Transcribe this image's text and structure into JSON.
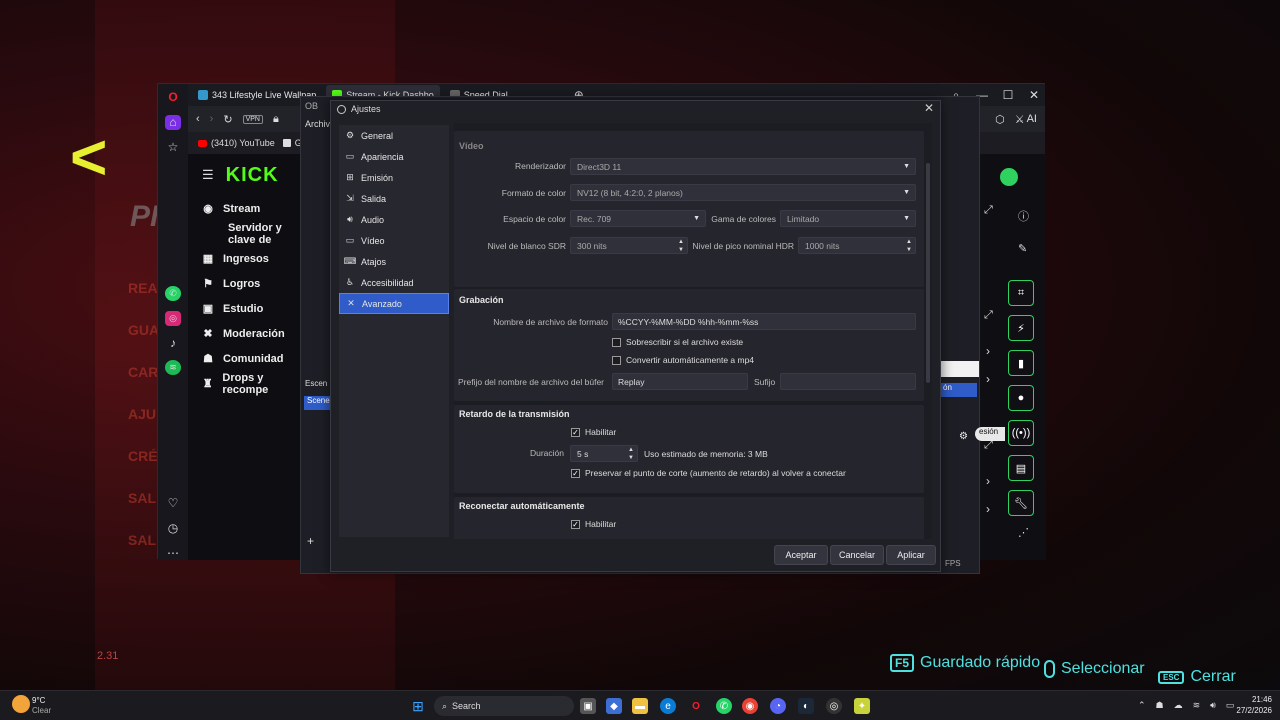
{
  "background": {
    "left_words": [
      "REA",
      "GUA",
      "CAR",
      "AJU",
      "CRÉ",
      "SAL",
      "SAL"
    ],
    "big_text": "PI",
    "corner_number": "2.31",
    "hud": [
      {
        "key": "F5",
        "label": "Guardado rápido"
      },
      {
        "key": "",
        "label": "Seleccionar"
      },
      {
        "key": "ESC",
        "label": "Cerrar"
      }
    ]
  },
  "browser": {
    "tabs": [
      {
        "label": "343 Lifestyle Live Wallpap"
      },
      {
        "label": "Stream - Kick Dashbo"
      },
      {
        "label": "Speed Dial"
      }
    ],
    "vpn_badge": "VPN",
    "bookmarks": [
      {
        "label": "(3410) YouTube"
      },
      {
        "label": "Goog"
      }
    ],
    "right_label": "AI",
    "kick": {
      "logo": "KICK",
      "menu": [
        {
          "icon": "stream-icon",
          "label": "Stream"
        },
        {
          "icon": "",
          "label": "Servidor y clave de"
        },
        {
          "icon": "ingresos-icon",
          "label": "Ingresos"
        },
        {
          "icon": "logros-icon",
          "label": "Logros"
        },
        {
          "icon": "estudio-icon",
          "label": "Estudio"
        },
        {
          "icon": "moderacion-icon",
          "label": "Moderación"
        },
        {
          "icon": "comunidad-icon",
          "label": "Comunidad"
        },
        {
          "icon": "drops-icon",
          "label": "Drops y recompe"
        }
      ],
      "right_badge": "esión",
      "right_badge2": "ón"
    }
  },
  "obs": {
    "menu_label": "Archiv",
    "scenes_label": "Escen",
    "scene_item": "Scene",
    "fps": "FPS",
    "ob_label": "OB"
  },
  "dialog": {
    "title": "Ajustes",
    "categories": [
      {
        "icon": "gear-icon",
        "label": "General"
      },
      {
        "icon": "monitor-icon",
        "label": "Apariencia"
      },
      {
        "icon": "broadcast-icon",
        "label": "Emisión"
      },
      {
        "icon": "output-icon",
        "label": "Salida"
      },
      {
        "icon": "speaker-icon",
        "label": "Audio"
      },
      {
        "icon": "video-icon",
        "label": "Vídeo"
      },
      {
        "icon": "keyboard-icon",
        "label": "Atajos"
      },
      {
        "icon": "accessibility-icon",
        "label": "Accesibilidad"
      },
      {
        "icon": "wrench-icon",
        "label": "Avanzado"
      }
    ],
    "selected_category": "Avanzado",
    "video": {
      "title": "Vídeo",
      "renderer_label": "Renderizador",
      "renderer_value": "Direct3D 11",
      "color_format_label": "Formato de color",
      "color_format_value": "NV12 (8 bit, 4:2:0, 2 planos)",
      "color_space_label": "Espacio de color",
      "color_space_value": "Rec. 709",
      "color_range_label": "Gama de colores",
      "color_range_value": "Limitado",
      "sdr_label": "Nivel de blanco SDR",
      "sdr_value": "300 nits",
      "hdr_label": "Nivel de pico nominal HDR",
      "hdr_value": "1000 nits"
    },
    "recording": {
      "title": "Grabación",
      "filename_label": "Nombre de archivo de formato",
      "filename_value": "%CCYY-%MM-%DD %hh-%mm-%ss",
      "overwrite_label": "Sobrescribir si el archivo existe",
      "overwrite_checked": false,
      "remux_label": "Convertir automáticamente a mp4",
      "remux_checked": false,
      "replay_prefix_label": "Prefijo del nombre de archivo del búfer",
      "replay_prefix_value": "Replay",
      "suffix_label": "Sufijo",
      "suffix_value": ""
    },
    "stream_delay": {
      "title": "Retardo de la transmisión",
      "enable_label": "Habilitar",
      "enable_checked": true,
      "duration_label": "Duración",
      "duration_value": "5 s",
      "memory_text": "Uso estimado de memoria: 3 MB",
      "preserve_label": "Preservar el punto de corte (aumento de retardo) al volver a conectar",
      "preserve_checked": true
    },
    "reconnect": {
      "title": "Reconectar automáticamente",
      "enable_label": "Habilitar",
      "enable_checked": true
    },
    "buttons": {
      "accept": "Aceptar",
      "cancel": "Cancelar",
      "apply": "Aplicar"
    }
  },
  "taskbar": {
    "weather_temp": "9°C",
    "weather_desc": "Clear",
    "search_label": "Search",
    "time": "21:46",
    "date": "27/2/2026"
  }
}
